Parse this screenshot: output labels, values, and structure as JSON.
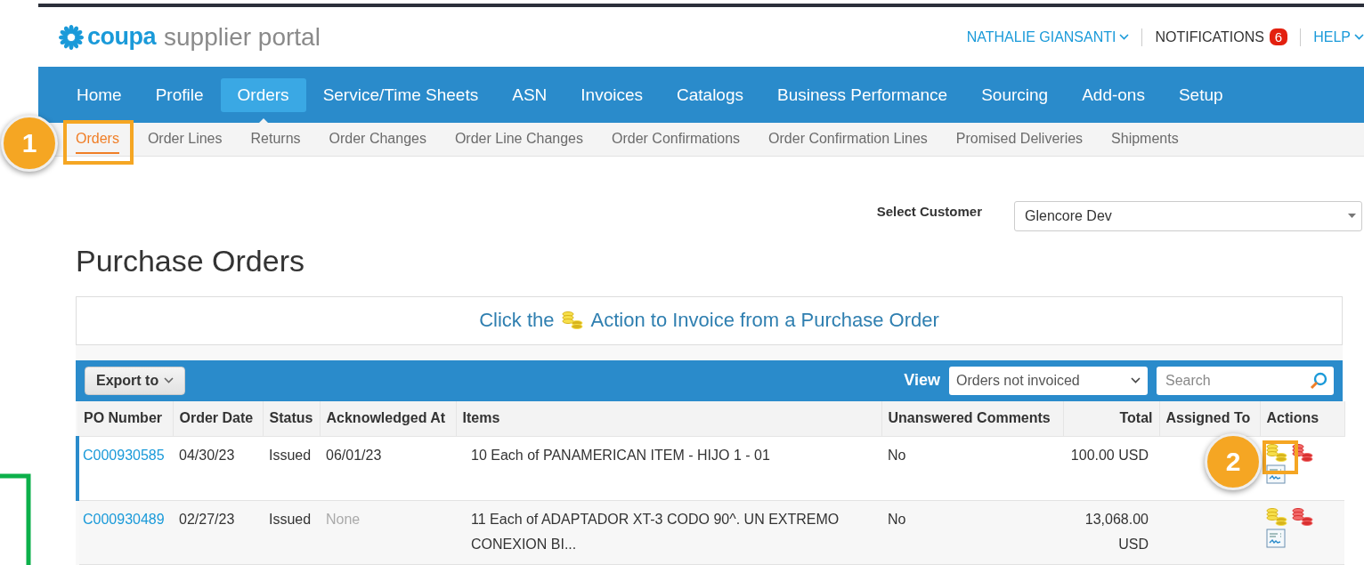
{
  "logo": {
    "brand": "coupa",
    "product": "supplier portal"
  },
  "user_menu": {
    "user": "NATHALIE GIANSANTI",
    "notifications": "NOTIFICATIONS",
    "notification_count": "6",
    "help": "HELP"
  },
  "nav": [
    {
      "label": "Home",
      "selected": false
    },
    {
      "label": "Profile",
      "selected": false
    },
    {
      "label": "Orders",
      "selected": true
    },
    {
      "label": "Service/Time Sheets",
      "selected": false
    },
    {
      "label": "ASN",
      "selected": false
    },
    {
      "label": "Invoices",
      "selected": false
    },
    {
      "label": "Catalogs",
      "selected": false
    },
    {
      "label": "Business Performance",
      "selected": false
    },
    {
      "label": "Sourcing",
      "selected": false
    },
    {
      "label": "Add-ons",
      "selected": false
    },
    {
      "label": "Setup",
      "selected": false
    }
  ],
  "subnav": [
    {
      "label": "Orders",
      "selected": true,
      "callout": "1"
    },
    {
      "label": "Order Lines",
      "selected": false
    },
    {
      "label": "Returns",
      "selected": false
    },
    {
      "label": "Order Changes",
      "selected": false
    },
    {
      "label": "Order Line Changes",
      "selected": false
    },
    {
      "label": "Order Confirmations",
      "selected": false
    },
    {
      "label": "Order Confirmation Lines",
      "selected": false
    },
    {
      "label": "Promised Deliveries",
      "selected": false
    },
    {
      "label": "Shipments",
      "selected": false
    }
  ],
  "customer": {
    "label": "Select Customer",
    "value": "Glencore Dev"
  },
  "title": "Purchase Orders",
  "banner": {
    "before": "Click the",
    "after": "Action to Invoice from a Purchase Order"
  },
  "toolbar": {
    "export": "Export to",
    "view_label": "View",
    "view_value": "Orders not invoiced",
    "search_placeholder": "Search"
  },
  "table": {
    "columns": [
      "PO Number",
      "Order Date",
      "Status",
      "Acknowledged At",
      "Items",
      "Unanswered Comments",
      "Total",
      "Assigned To",
      "Actions"
    ],
    "rows": [
      {
        "selected": true,
        "po": "C000930585",
        "date": "04/30/23",
        "status": "Issued",
        "acknowledged": "06/01/23",
        "acknowledged_none": false,
        "items": "10 Each of PANAMERICAN ITEM - HIJO 1 - 01",
        "comments": "No",
        "total": "100.00 USD",
        "callout": "2"
      },
      {
        "selected": false,
        "po": "C000930489",
        "date": "02/27/23",
        "status": "Issued",
        "acknowledged": "None",
        "acknowledged_none": true,
        "items": "11 Each of ADAPTADOR XT-3 CODO 90^. UN EXTREMO CONEXION BI...",
        "comments": "No",
        "total": "13,068.00 USD"
      }
    ]
  }
}
